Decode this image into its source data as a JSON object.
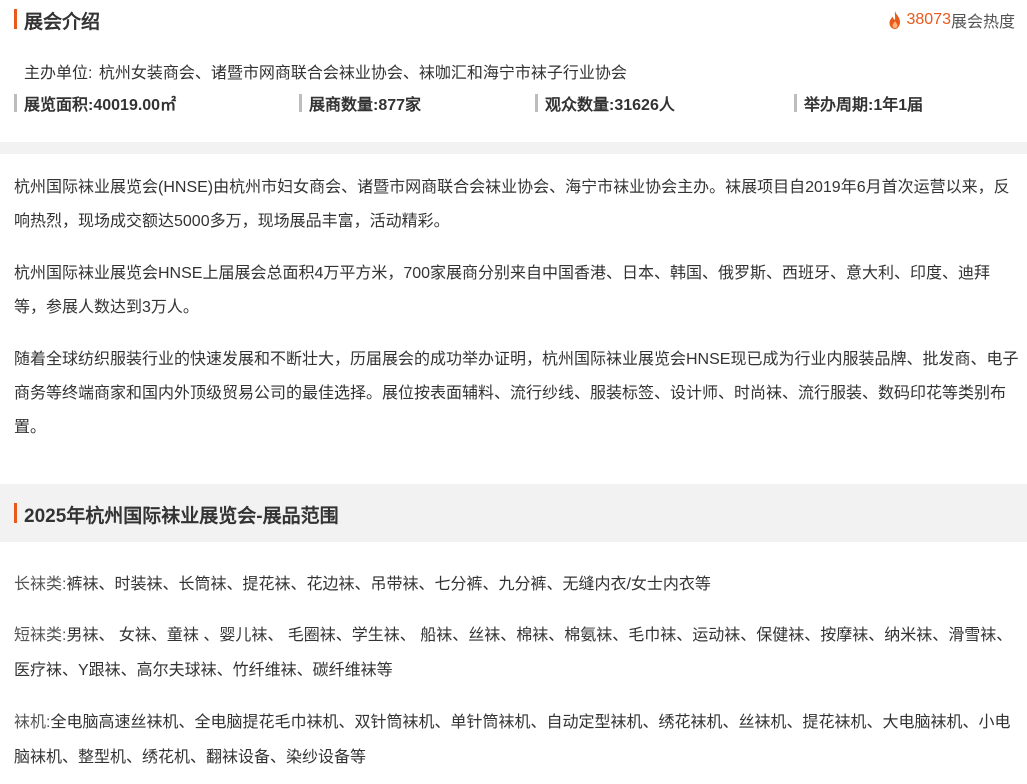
{
  "intro": {
    "title": "展会介绍",
    "heat_count": "38073",
    "heat_label": "展会热度",
    "organizer_label": "主办单位:",
    "organizer_value": "杭州女装商会、诸暨市网商联合会袜业协会、袜咖汇和海宁市袜子行业协会",
    "stats": [
      {
        "label": "展览面积:",
        "value": "40019.00㎡"
      },
      {
        "label": "展商数量:",
        "value": "877家"
      },
      {
        "label": "观众数量:",
        "value": "31626人"
      },
      {
        "label": "举办周期:",
        "value": "1年1届"
      }
    ],
    "paragraphs": [
      "杭州国际袜业展览会(HNSE)由杭州市妇女商会、诸暨市网商联合会袜业协会、海宁市袜业协会主办。袜展项目自2019年6月首次运营以来，反响热烈，现场成交额达5000多万，现场展品丰富，活动精彩。",
      "杭州国际袜业展览会HNSE上届展会总面积4万平方米，700家展商分别来自中国香港、日本、韩国、俄罗斯、西班牙、意大利、印度、迪拜等，参展人数达到3万人。",
      "随着全球纺织服装行业的快速发展和不断壮大，历届展会的成功举办证明，杭州国际袜业展览会HNSE现已成为行业内服装品牌、批发商、电子商务等终端商家和国内外顶级贸易公司的最佳选择。展位按表面辅料、流行纱线、服装标签、设计师、时尚袜、流行服装、数码印花等类别布置。"
    ]
  },
  "scope": {
    "title": "2025年杭州国际袜业展览会-展品范围",
    "categories": [
      {
        "label": "长袜类:",
        "items": "裤袜、时装袜、长筒袜、提花袜、花边袜、吊带袜、七分裤、九分裤、无缝内衣/女士内衣等"
      },
      {
        "label": "短袜类:",
        "items": "男袜、 女袜、童袜 、婴儿袜、 毛圈袜、学生袜、 船袜、丝袜、棉袜、棉氨袜、毛巾袜、运动袜、保健袜、按摩袜、纳米袜、滑雪袜、医疗袜、Y跟袜、高尔夫球袜、竹纤维袜、碳纤维袜等"
      },
      {
        "label": "袜机:",
        "items": "全电脑高速丝袜机、全电脑提花毛巾袜机、双针筒袜机、单针筒袜机、自动定型袜机、绣花袜机、丝袜机、提花袜机、大电脑袜机、小电脑袜机、整型机、绣花机、翻袜设备、染纱设备等"
      }
    ]
  },
  "colors": {
    "accent": "#e8591a",
    "band": "#f2f2f2",
    "stat_bar": "#bdbdbd"
  },
  "icons": {
    "heat": "fire-icon"
  }
}
